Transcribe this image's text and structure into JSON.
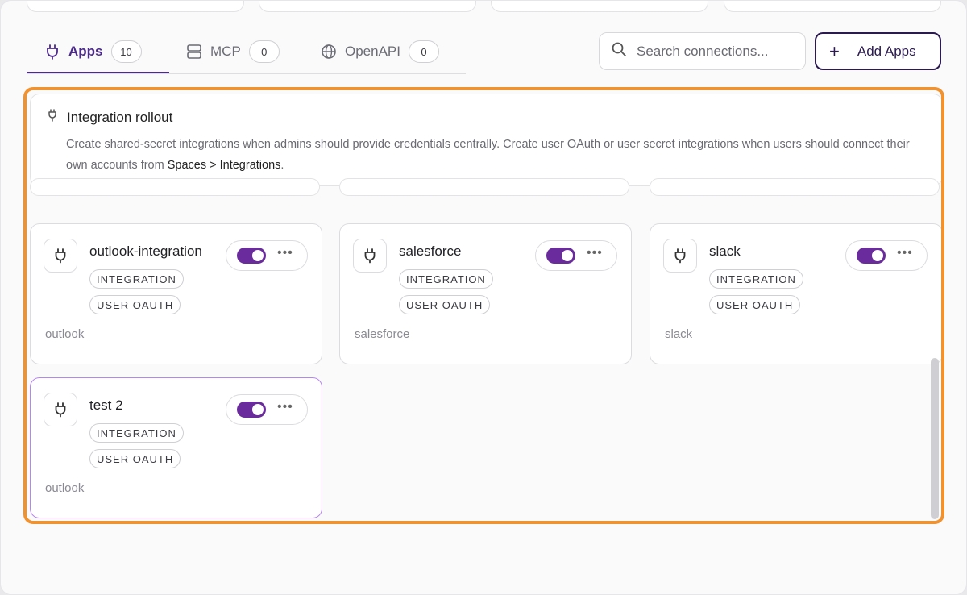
{
  "tabs": [
    {
      "label": "Apps",
      "count": "10",
      "icon": "plug-icon"
    },
    {
      "label": "MCP",
      "count": "0",
      "icon": "server-icon"
    },
    {
      "label": "OpenAPI",
      "count": "0",
      "icon": "globe-icon"
    }
  ],
  "search": {
    "placeholder": "Search connections..."
  },
  "add_button": {
    "label": "Add Apps",
    "icon": "plus-icon"
  },
  "banner": {
    "title": "Integration rollout",
    "text_before": "Create shared-secret integrations when admins should provide credentials centrally. Create user OAuth or user secret integrations when users should connect their own accounts from ",
    "text_emphasis": "Spaces > Integrations",
    "text_after": "."
  },
  "cards": [
    {
      "name": "outlook-integration",
      "tags": [
        "INTEGRATION",
        "USER OAUTH"
      ],
      "provider": "outlook",
      "enabled": true
    },
    {
      "name": "salesforce",
      "tags": [
        "INTEGRATION",
        "USER OAUTH"
      ],
      "provider": "salesforce",
      "enabled": true
    },
    {
      "name": "slack",
      "tags": [
        "INTEGRATION",
        "USER OAUTH"
      ],
      "provider": "slack",
      "enabled": true
    },
    {
      "name": "test 2",
      "tags": [
        "INTEGRATION",
        "USER OAUTH"
      ],
      "provider": "outlook",
      "enabled": true
    }
  ],
  "more_label": "•••",
  "colors": {
    "accent": "#4b2a8a",
    "toggle": "#6a2c9c",
    "highlight": "#f0922f",
    "selected_border": "#b785f0"
  }
}
